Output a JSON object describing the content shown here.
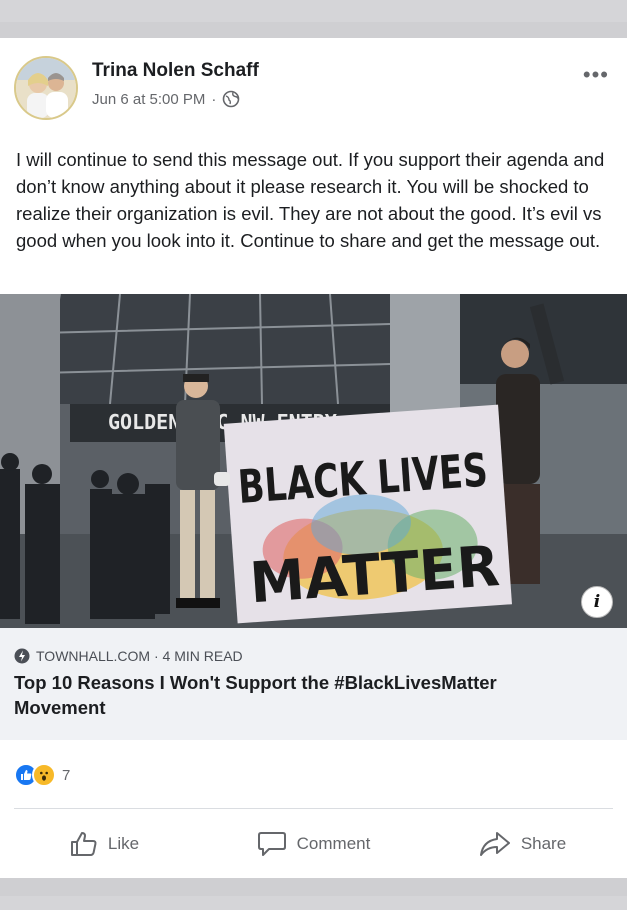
{
  "post": {
    "author": "Trina Nolen Schaff",
    "timestamp": "Jun 6 at 5:00 PM",
    "separator": "·",
    "text": "I will continue to send this message out. If you support their agenda and don’t know anything about it please research it. You will be shocked to realize their organization is evil. They are not about the good. It’s evil vs good when you look into it. Continue to share and get the message out.",
    "more_label": "•••"
  },
  "image": {
    "sign_text": "GOLDEN 1 C   NW ENTRY",
    "banner_line1": "BLACK LIVES",
    "banner_line2": "MATTER"
  },
  "link": {
    "source": "TOWNHALL.COM · 4 MIN READ",
    "title": "Top 10 Reasons I Won't Support the #BlackLivesMatter Movement"
  },
  "reactions": {
    "count": "7"
  },
  "actions": {
    "like": "Like",
    "comment": "Comment",
    "share": "Share"
  },
  "colors": {
    "like_blue": "#1877f2",
    "wow_yellow": "#f7b928",
    "muted_text": "#65676b",
    "link_box_bg": "#f0f2f5"
  }
}
